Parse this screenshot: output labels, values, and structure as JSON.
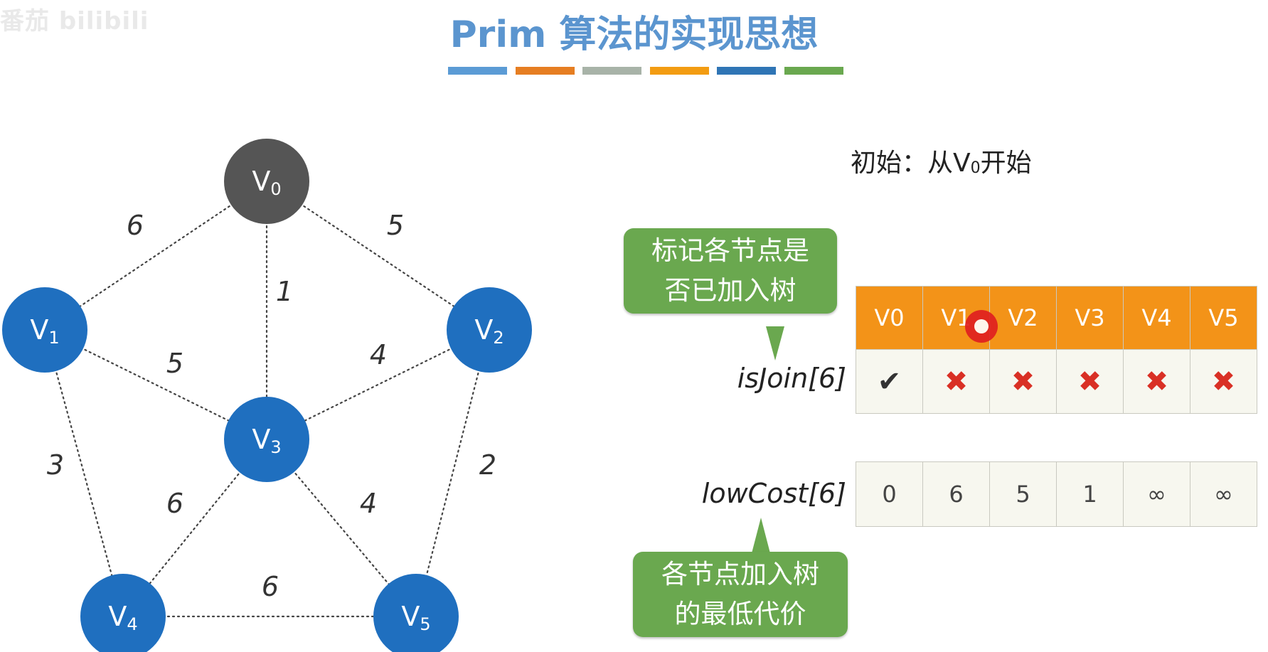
{
  "watermark": "番茄 bilibili",
  "title": "Prim 算法的实现思想",
  "color_bars": [
    "#5b9bd5",
    "#e67e22",
    "#a8b3a8",
    "#f39c12",
    "#2f75b5",
    "#6aa84f"
  ],
  "graph": {
    "node_colors": {
      "start": "#555555",
      "other": "#1f6fbf"
    },
    "nodes": [
      {
        "id": "v0",
        "base": "V",
        "sub": "0",
        "type": "start"
      },
      {
        "id": "v1",
        "base": "V",
        "sub": "1",
        "type": "other"
      },
      {
        "id": "v2",
        "base": "V",
        "sub": "2",
        "type": "other"
      },
      {
        "id": "v3",
        "base": "V",
        "sub": "3",
        "type": "other"
      },
      {
        "id": "v4",
        "base": "V",
        "sub": "4",
        "type": "other"
      },
      {
        "id": "v5",
        "base": "V",
        "sub": "5",
        "type": "other"
      }
    ],
    "edges": [
      {
        "from": "v0",
        "to": "v1",
        "weight": "6"
      },
      {
        "from": "v0",
        "to": "v2",
        "weight": "5"
      },
      {
        "from": "v0",
        "to": "v3",
        "weight": "1"
      },
      {
        "from": "v1",
        "to": "v3",
        "weight": "5"
      },
      {
        "from": "v2",
        "to": "v3",
        "weight": "4"
      },
      {
        "from": "v1",
        "to": "v4",
        "weight": "3"
      },
      {
        "from": "v2",
        "to": "v5",
        "weight": "2"
      },
      {
        "from": "v3",
        "to": "v4",
        "weight": "6"
      },
      {
        "from": "v3",
        "to": "v5",
        "weight": "4"
      },
      {
        "from": "v4",
        "to": "v5",
        "weight": "6"
      }
    ]
  },
  "intro": {
    "prefix": "初始：从V",
    "sub": "0",
    "suffix": "开始"
  },
  "bubble_top": {
    "line1": "标记各节点是",
    "line2": "否已加入树"
  },
  "bubble_bottom": {
    "line1": "各节点加入树",
    "line2": "的最低代价"
  },
  "is_join": {
    "label": "isJoin[6]",
    "headers": [
      "V0",
      "V1",
      "V2",
      "V3",
      "V4",
      "V5"
    ],
    "values": [
      "✔",
      "✖",
      "✖",
      "✖",
      "✖",
      "✖"
    ]
  },
  "low_cost": {
    "label": "lowCost[6]",
    "values": [
      "0",
      "6",
      "5",
      "1",
      "∞",
      "∞"
    ]
  }
}
